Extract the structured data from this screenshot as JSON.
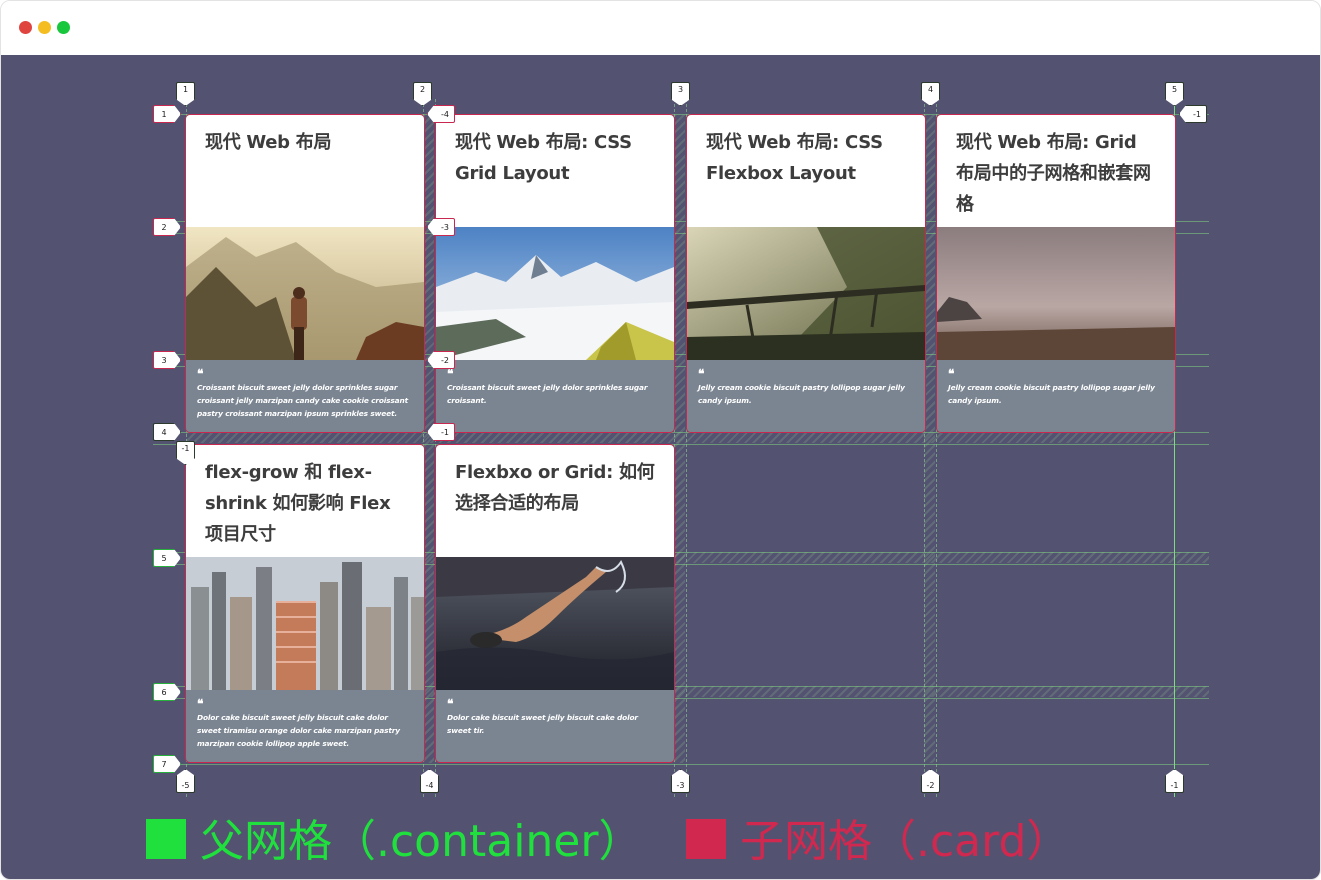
{
  "window": {
    "controls": [
      "close",
      "minimize",
      "maximize"
    ]
  },
  "cards": [
    {
      "title": "现代 Web 布局",
      "quote_icon": "❝",
      "quote": "Croissant biscuit sweet jelly dolor sprinkles sugar croissant jelly marzipan candy cake cookie croissant pastry croissant marzipan ipsum sprinkles sweet.",
      "image": "hiker-on-misty-mountain"
    },
    {
      "title": "现代 Web 布局: CSS Grid Layout",
      "quote_icon": "❝",
      "quote": "Croissant biscuit sweet jelly dolor sprinkles sugar croissant.",
      "image": "snowy-mountains-tent"
    },
    {
      "title": "现代 Web 布局: CSS Flexbox Layout",
      "quote_icon": "❝",
      "quote": "Jelly cream cookie biscuit pastry lollipop sugar jelly candy ipsum.",
      "image": "foggy-forest-bridge"
    },
    {
      "title": "现代 Web 布局: Grid 布局中的子网格和嵌套网格",
      "quote_icon": "❝",
      "quote": "Jelly cream cookie biscuit pastry lollipop sugar jelly candy ipsum.",
      "image": "misty-plain"
    },
    {
      "title": "flex-grow 和 flex-shrink 如何影响 Flex 项目尺寸",
      "quote_icon": "❝",
      "quote": "Dolor cake biscuit sweet jelly biscuit cake dolor sweet tiramisu orange dolor cake marzipan pastry marzipan cookie lollipop apple sweet.",
      "image": "city-skyline"
    },
    {
      "title": "Flexbxo or Grid: 如何选择合适的布局",
      "quote_icon": "❝",
      "quote": "Dolor cake biscuit sweet jelly biscuit cake dolor sweet tir.",
      "image": "swimmer-in-water"
    }
  ],
  "grid_labels": {
    "col_top": [
      "1",
      "2",
      "3",
      "4",
      "5"
    ],
    "col_bottom": [
      "-5",
      "-4",
      "-3",
      "-2",
      "-1"
    ],
    "row_left": [
      "1",
      "2",
      "3",
      "4",
      "5",
      "6",
      "7"
    ],
    "row_right_top": "-1",
    "row_left_bottom": "-1",
    "subgrid_col_top": "2",
    "subgrid_row": [
      "-4",
      "-3",
      "-2",
      "-1"
    ]
  },
  "legend": {
    "parent": "父网格（.container）",
    "child": "子网格（.card）",
    "parent_color": "#1fe03c",
    "child_color": "#d0284f"
  },
  "colors": {
    "background": "#535371",
    "card_quote_bg": "#7b8592",
    "grid_line": "#7fe87f",
    "subgrid_border": "#c8284f"
  }
}
